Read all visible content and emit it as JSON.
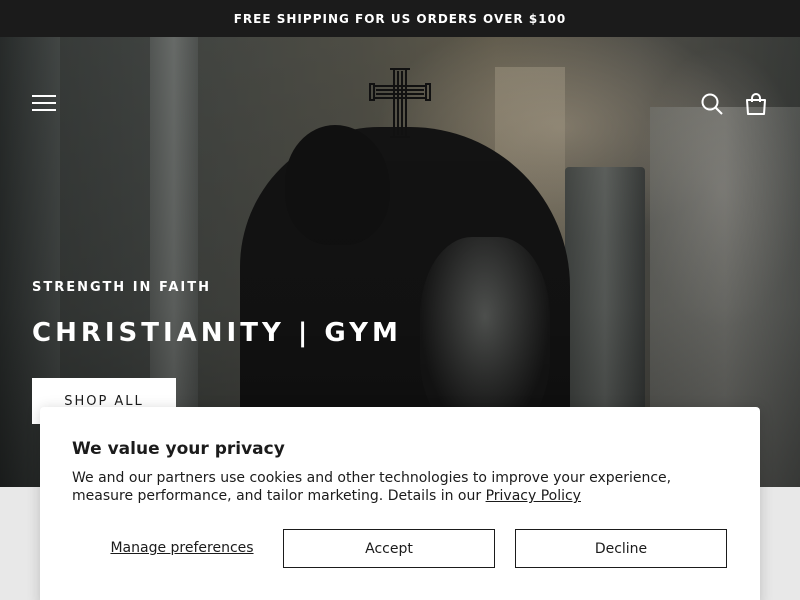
{
  "announcement": {
    "text": "FREE SHIPPING FOR US ORDERS OVER $100"
  },
  "header": {
    "menu_icon": "hamburger-menu-icon",
    "logo_icon": "cross-logo-icon",
    "search_icon": "search-icon",
    "cart_icon": "shopping-bag-icon"
  },
  "hero": {
    "subheading": "STRENGTH IN FAITH",
    "heading": "CHRISTIANITY | GYM",
    "cta_label": "SHOP ALL"
  },
  "cookie_banner": {
    "title": "We value your privacy",
    "text": "We and our partners use cookies and other technologies to improve your experience, measure performance, and tailor marketing. Details in our ",
    "privacy_link": "Privacy Policy",
    "manage_label": "Manage preferences",
    "accept_label": "Accept",
    "decline_label": "Decline"
  },
  "colors": {
    "announcement_bg": "#1b1b1b",
    "text_dark": "#1b1b1b",
    "white": "#ffffff"
  }
}
